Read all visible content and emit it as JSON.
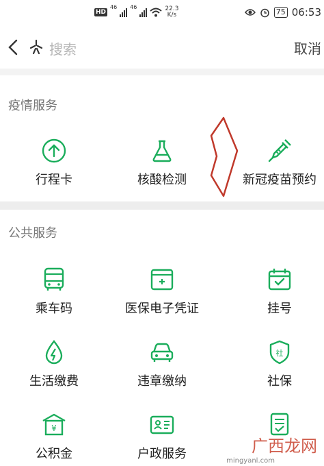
{
  "status_bar": {
    "hd": "HD",
    "net1": "46",
    "net2": "46",
    "speed_value": "22.3",
    "speed_unit": "K/s",
    "battery": "75",
    "time": "06:53"
  },
  "search": {
    "placeholder": "搜索",
    "cancel_label": "取消"
  },
  "sections": {
    "epidemic": {
      "title": "疫情服务",
      "items": [
        {
          "label": "行程卡",
          "icon": "arrow-up-circle-icon"
        },
        {
          "label": "核酸检测",
          "icon": "flask-icon"
        },
        {
          "label": "新冠疫苗预约",
          "icon": "syringe-icon"
        }
      ]
    },
    "public": {
      "title": "公共服务",
      "items": [
        {
          "label": "乘车码",
          "icon": "bus-icon"
        },
        {
          "label": "医保电子凭证",
          "icon": "medical-card-icon"
        },
        {
          "label": "挂号",
          "icon": "calendar-check-icon"
        },
        {
          "label": "生活缴费",
          "icon": "water-drop-bolt-icon"
        },
        {
          "label": "违章缴纳",
          "icon": "car-icon"
        },
        {
          "label": "社保",
          "icon": "shield-icon"
        },
        {
          "label": "公积金",
          "icon": "house-yuan-icon"
        },
        {
          "label": "户政服务",
          "icon": "id-card-icon"
        },
        {
          "label": "",
          "icon": "document-check-icon"
        }
      ]
    }
  },
  "watermark": {
    "text": "广西龙网",
    "url": "mingyanl.com"
  },
  "colors": {
    "accent": "#1aad5b",
    "annotation_arrow": "#c0392b"
  }
}
